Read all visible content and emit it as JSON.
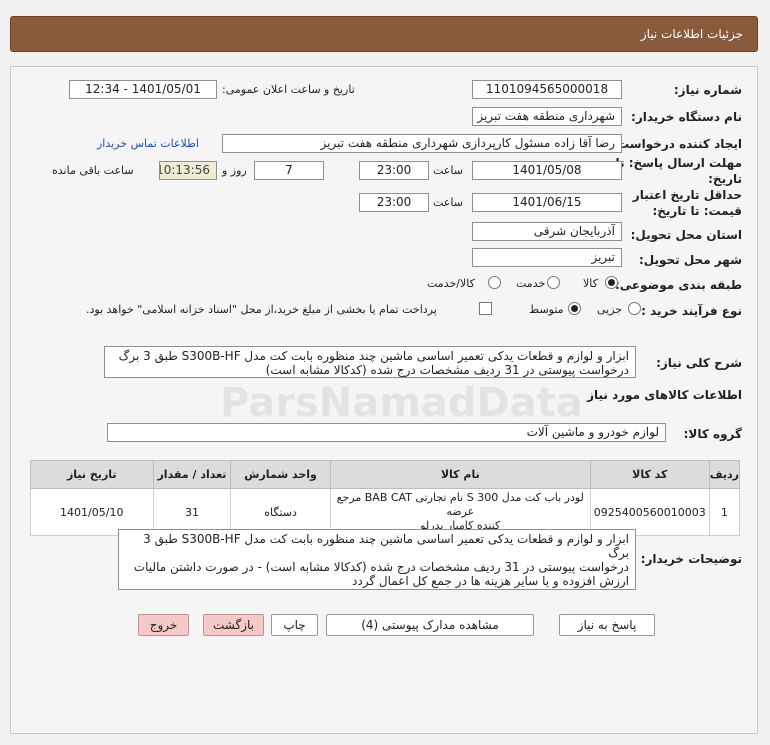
{
  "header": {
    "title": "جزئیات اطلاعات نیاز"
  },
  "form": {
    "need_number_label": "شماره نیاز:",
    "need_number": "1101094565000018",
    "announce_label": "تاریخ و ساعت اعلان عمومی:",
    "announce_value": "1401/05/01 - 12:34",
    "buyer_org_label": "نام دستگاه خریدار:",
    "buyer_org": "شهرداری منطقه هفت تبریز",
    "requester_label": "ایجاد کننده درخواست:",
    "requester": "رضا آقا زاده مسئول کارپردازی شهرداری منطقه هفت تبریز",
    "contact_link": "اطلاعات تماس خریدار",
    "deadline_label_1": "مهلت ارسال پاسخ: تا",
    "deadline_label_2": "تاریخ:",
    "deadline_date": "1401/05/08",
    "time_label": "ساعت",
    "deadline_time": "23:00",
    "days_value": "7",
    "days_label": "روز و",
    "remaining_time": "10:13:56",
    "remaining_label": "ساعت باقی مانده",
    "validity_label_1": "حداقل تاریخ اعتبار",
    "validity_label_2": "قیمت: تا تاریخ:",
    "validity_date": "1401/06/15",
    "validity_time": "23:00",
    "province_label": "استان محل تحویل:",
    "province": "آذربایجان شرقی",
    "city_label": "شهر محل تحویل:",
    "city": "تبریز",
    "category_label": "طبقه بندی موضوعی:",
    "category_options": [
      "کالا",
      "خدمت",
      "کالا/خدمت"
    ],
    "category_selected": "کالا",
    "process_label": "نوع فرآیند خرید :",
    "process_options": [
      "جزیی",
      "متوسط"
    ],
    "process_selected": "متوسط",
    "payment_note": "پرداخت تمام یا بخشی از مبلغ خرید،از محل \"اسناد خزانه اسلامی\" خواهد بود."
  },
  "summary": {
    "label": "شرح کلی نیاز:",
    "line1": "ابزار و لوازم و قطعات یدکی تعمیر اساسی ماشین چند منظوره بابت کت مدل S300B-HF طبق 3 برگ",
    "line2": "درخواست پیوستی در   31 ردیف مشخصات درج شده (کدکالا مشابه است)"
  },
  "goods_section": {
    "title": "اطلاعات کالاهای مورد نیاز"
  },
  "goods_group": {
    "label": "گروه کالا:",
    "value": "لوازم خودرو و ماشین آلات"
  },
  "table": {
    "headers": [
      "ردیف",
      "کد کالا",
      "نام کالا",
      "واحد شمارش",
      "تعداد / مقدار",
      "تاریخ نیاز"
    ],
    "rows": [
      {
        "row": "1",
        "code": "0925400560010003",
        "name_line1": "لودر باب کت مدل S 300 نام تجارتی BAB CAT مرجع عرضه",
        "name_line2": "کننده کامیار بدرلو",
        "unit": "دستگاه",
        "qty": "31",
        "date": "1401/05/10"
      }
    ]
  },
  "notes": {
    "label": "توضیحات خریدار:",
    "line1": "ابزار و لوازم و قطعات یدکی تعمیر اساسی ماشین چند منظوره بابت کت مدل S300B-HF طبق 3 برگ",
    "line2": "درخواست پیوستی در   31 ردیف مشخصات درج شده (کدکالا مشابه است) - در صورت داشتن مالیات",
    "line3": "ارزش افزوده و یا سایر هزینه ها در جمع کل اعمال گردد"
  },
  "buttons": {
    "reply": "پاسخ به نیاز",
    "attachments": "مشاهده مدارک پیوستی (4)",
    "print": "چاپ",
    "back": "بازگشت",
    "exit": "خروج"
  }
}
